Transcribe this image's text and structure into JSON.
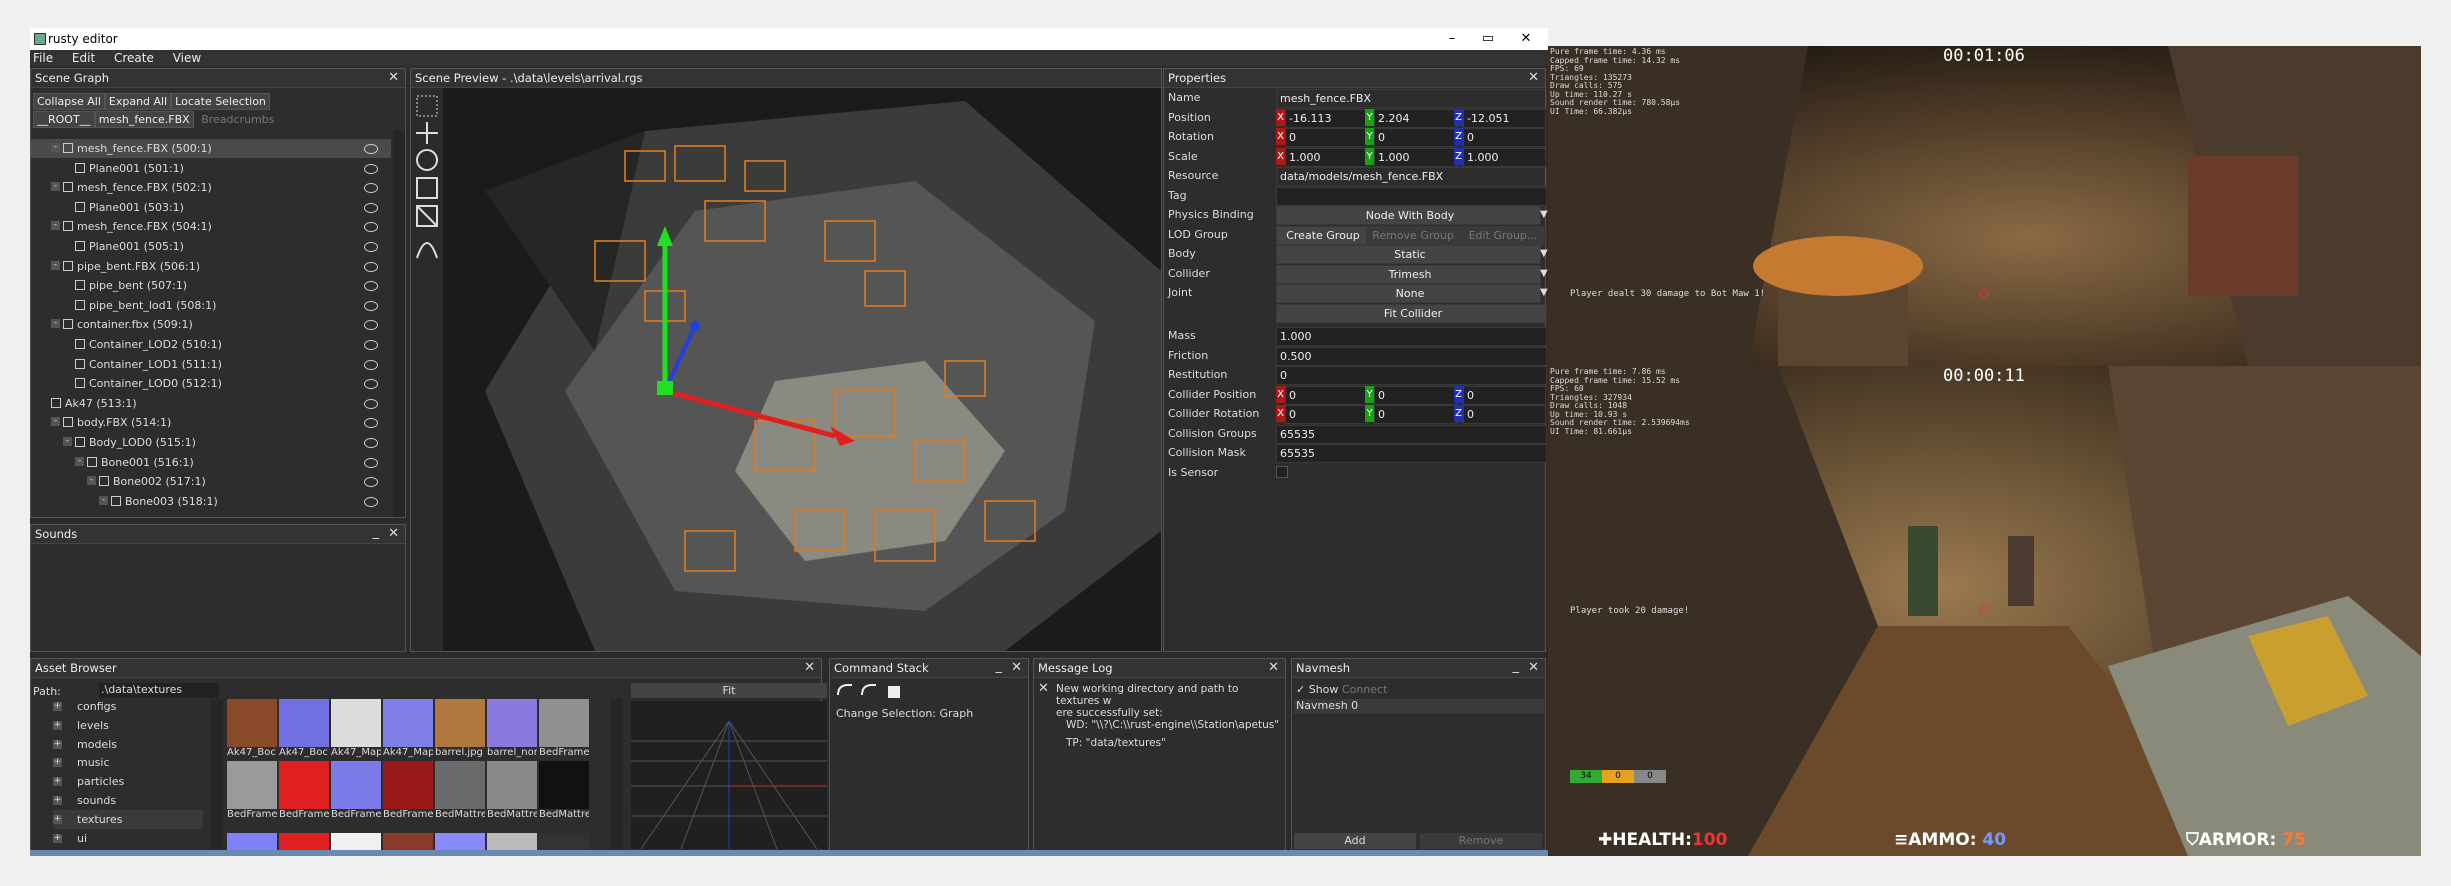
{
  "window": {
    "title": "rusty editor",
    "minimize": "–",
    "maximize": "▭",
    "close": "✕"
  },
  "menu": [
    "File",
    "Edit",
    "Create",
    "View"
  ],
  "scene_graph": {
    "title": "Scene Graph",
    "toolbar": [
      "Collapse All",
      "Expand All",
      "Locate Selection"
    ],
    "breadcrumbs": [
      "__ROOT__",
      "mesh_fence.FBX"
    ],
    "breadcrumbs_label": "Breadcrumbs",
    "items": [
      {
        "label": "mesh_fence.FBX (500:1)",
        "indent": 1,
        "expander": "-",
        "selected": true
      },
      {
        "label": "Plane001 (501:1)",
        "indent": 2,
        "expander": ""
      },
      {
        "label": "mesh_fence.FBX (502:1)",
        "indent": 1,
        "expander": "-"
      },
      {
        "label": "Plane001 (503:1)",
        "indent": 2,
        "expander": ""
      },
      {
        "label": "mesh_fence.FBX (504:1)",
        "indent": 1,
        "expander": "-"
      },
      {
        "label": "Plane001 (505:1)",
        "indent": 2,
        "expander": ""
      },
      {
        "label": "pipe_bent.FBX (506:1)",
        "indent": 1,
        "expander": "-"
      },
      {
        "label": "pipe_bent (507:1)",
        "indent": 2,
        "expander": ""
      },
      {
        "label": "pipe_bent_lod1 (508:1)",
        "indent": 2,
        "expander": ""
      },
      {
        "label": "container.fbx (509:1)",
        "indent": 1,
        "expander": "-"
      },
      {
        "label": "Container_LOD2 (510:1)",
        "indent": 2,
        "expander": ""
      },
      {
        "label": "Container_LOD1 (511:1)",
        "indent": 2,
        "expander": ""
      },
      {
        "label": "Container_LOD0 (512:1)",
        "indent": 2,
        "expander": ""
      },
      {
        "label": "Ak47 (513:1)",
        "indent": 0,
        "expander": ""
      },
      {
        "label": "body.FBX (514:1)",
        "indent": 1,
        "expander": "-"
      },
      {
        "label": "Body_LOD0 (515:1)",
        "indent": 2,
        "expander": "-"
      },
      {
        "label": "Bone001 (516:1)",
        "indent": 3,
        "expander": "-"
      },
      {
        "label": "Bone002 (517:1)",
        "indent": 4,
        "expander": "-"
      },
      {
        "label": "Bone003 (518:1)",
        "indent": 5,
        "expander": "-"
      }
    ]
  },
  "sounds": {
    "title": "Sounds"
  },
  "scene_preview": {
    "title": "Scene Preview - .\\data\\levels\\arrival.rgs"
  },
  "properties": {
    "title": "Properties",
    "name": {
      "label": "Name",
      "value": "mesh_fence.FBX"
    },
    "position": {
      "label": "Position",
      "x": "-16.113",
      "y": "2.204",
      "z": "-12.051"
    },
    "rotation": {
      "label": "Rotation",
      "x": "0",
      "y": "0",
      "z": "0"
    },
    "scale": {
      "label": "Scale",
      "x": "1.000",
      "y": "1.000",
      "z": "1.000"
    },
    "resource": {
      "label": "Resource",
      "value": "data/models/mesh_fence.FBX"
    },
    "tag": {
      "label": "Tag",
      "value": ""
    },
    "physics_binding": {
      "label": "Physics Binding",
      "value": "Node With Body"
    },
    "lod_group": {
      "label": "LOD Group",
      "create": "Create Group",
      "remove": "Remove Group",
      "edit": "Edit Group..."
    },
    "body": {
      "label": "Body",
      "value": "Static"
    },
    "collider": {
      "label": "Collider",
      "value": "Trimesh"
    },
    "joint": {
      "label": "Joint",
      "value": "None"
    },
    "fit_collider": "Fit Collider",
    "mass": {
      "label": "Mass",
      "value": "1.000"
    },
    "friction": {
      "label": "Friction",
      "value": "0.500"
    },
    "restitution": {
      "label": "Restitution",
      "value": "0"
    },
    "collider_position": {
      "label": "Collider Position",
      "x": "0",
      "y": "0",
      "z": "0"
    },
    "collider_rotation": {
      "label": "Collider Rotation",
      "x": "0",
      "y": "0",
      "z": "0"
    },
    "collision_groups": {
      "label": "Collision Groups",
      "value": "65535"
    },
    "collision_mask": {
      "label": "Collision Mask",
      "value": "65535"
    },
    "is_sensor": {
      "label": "Is Sensor"
    },
    "axis_x": "X",
    "axis_y": "Y",
    "axis_z": "Z"
  },
  "asset_browser": {
    "title": "Asset Browser",
    "path_label": "Path:",
    "path_value": ".\\data\\textures",
    "folders": [
      "configs",
      "levels",
      "models",
      "music",
      "particles",
      "sounds",
      "textures",
      "ui"
    ],
    "thumbs_row1": [
      "Ak47_Boc",
      "Ak47_Boc",
      "Ak47_Map",
      "Ak47_Map",
      "barrel.jpg",
      "barrel_nor",
      "BedFrame"
    ],
    "thumbs_row2": [
      "BedFrame",
      "BedFrame",
      "BedFrame",
      "BedFrame",
      "BedMattre",
      "BedMattre",
      "BedMattre"
    ],
    "fit": "Fit"
  },
  "command_stack": {
    "title": "Command Stack",
    "entries": [
      "Change Selection: Graph"
    ]
  },
  "message_log": {
    "title": "Message Log",
    "lines": [
      "New working directory and path to textures w",
      "ere successfully set:",
      "WD: \"\\\\?\\C:\\\\rust-engine\\\\Station\\apetus\"",
      "TP: \"data/textures\""
    ]
  },
  "navmesh": {
    "title": "Navmesh",
    "show": "Show",
    "connect": "Connect",
    "items": [
      "Navmesh 0"
    ],
    "add": "Add",
    "remove": "Remove"
  },
  "game_top": {
    "timer": "00:01:06",
    "stats": [
      "Pure frame time: 4.36 ms",
      "Capped frame time: 14.32 ms",
      "FPS: 69",
      "Triangles: 135273",
      "Draw calls: 575",
      "Up time: 110.27 s",
      "Sound render time: 780.58µs",
      "UI Time: 66.382µs"
    ],
    "message": "Player dealt 30 damage to Bot Maw 1!"
  },
  "game_bottom": {
    "timer": "00:00:11",
    "stats": [
      "Pure frame time: 7.86 ms",
      "Capped frame time: 15.52 ms",
      "FPS: 60",
      "Triangles: 327934",
      "Draw calls: 1048",
      "Up time: 10.93 s",
      "Sound render time: 2.539694ms",
      "UI Time: 81.661µs"
    ],
    "message": "Player took 20 damage!",
    "bars": [
      "34",
      "0",
      "0"
    ],
    "health_label": "HEALTH:",
    "health_value": "100",
    "ammo_label": "AMMO:",
    "ammo_value": "40",
    "armor_label": "ARMOR:",
    "armor_value": "75"
  }
}
